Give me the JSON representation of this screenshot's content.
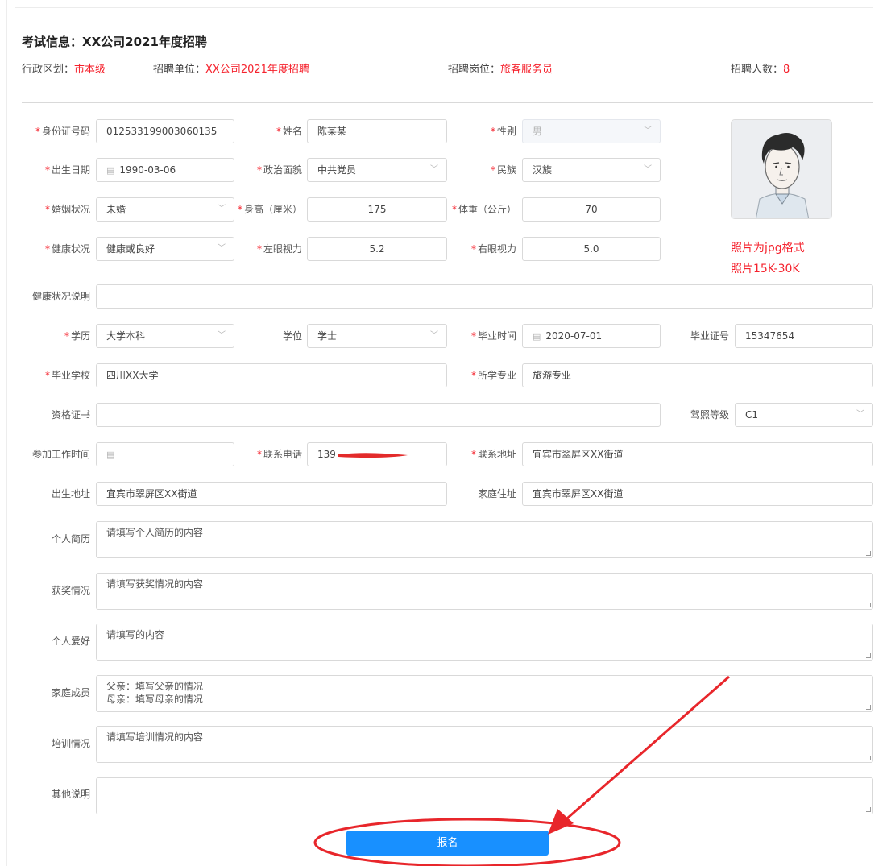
{
  "exam": {
    "title": "考试信息：XX公司2021年度招聘",
    "district_label": "行政区划：",
    "district_value": "市本级",
    "unit_label": "招聘单位：",
    "unit_value": "XX公司2021年度招聘",
    "post_label": "招聘岗位：",
    "post_value": "旅客服务员",
    "count_label": "招聘人数：",
    "count_value": "8"
  },
  "form": {
    "id_label": "身份证号码",
    "id_value": "012533199003060135",
    "name_label": "姓名",
    "name_value": "陈某某",
    "gender_label": "性别",
    "gender_value": "男",
    "birth_label": "出生日期",
    "birth_value": "1990-03-06",
    "politics_label": "政治面貌",
    "politics_value": "中共党员",
    "ethnic_label": "民族",
    "ethnic_value": "汉族",
    "marital_label": "婚姻状况",
    "marital_value": "未婚",
    "height_label": "身高（厘米）",
    "height_value": "175",
    "weight_label": "体重（公斤）",
    "weight_value": "70",
    "health_label": "健康状况",
    "health_value": "健康或良好",
    "left_eye_label": "左眼视力",
    "left_eye_value": "5.2",
    "right_eye_label": "右眼视力",
    "right_eye_value": "5.0",
    "health_note_label": "健康状况说明",
    "health_note_value": "",
    "education_label": "学历",
    "education_value": "大学本科",
    "degree_label": "学位",
    "degree_value": "学士",
    "grad_time_label": "毕业时间",
    "grad_time_value": "2020-07-01",
    "grad_cert_label": "毕业证号",
    "grad_cert_value": "15347654",
    "school_label": "毕业学校",
    "school_value": "四川XX大学",
    "major_label": "所学专业",
    "major_value": "旅游专业",
    "qualification_label": "资格证书",
    "qualification_value": "",
    "license_label": "驾照等级",
    "license_value": "C1",
    "work_start_label": "参加工作时间",
    "work_start_value": "",
    "phone_label": "联系电话",
    "phone_value": "139",
    "address_label": "联系地址",
    "address_value": "宜宾市翠屏区XX街道",
    "birthplace_label": "出生地址",
    "birthplace_value": "宜宾市翠屏区XX街道",
    "home_label": "家庭住址",
    "home_value": "宜宾市翠屏区XX街道",
    "resume_label": "个人简历",
    "resume_value": "请填写个人简历的内容",
    "awards_label": "获奖情况",
    "awards_value": "请填写获奖情况的内容",
    "hobby_label": "个人爱好",
    "hobby_value": "请填写的内容",
    "family_label": "家庭成员",
    "family_value": "父亲：填写父亲的情况\n母亲：填写母亲的情况",
    "training_label": "培训情况",
    "training_value": "请填写培训情况的内容",
    "other_label": "其他说明",
    "other_value": ""
  },
  "photo": {
    "note_format": "照片为jpg格式",
    "note_size": "照片15K-30K"
  },
  "submit": {
    "label": "报名"
  },
  "colors": {
    "accent": "#1890ff",
    "highlight": "#f5222d",
    "annotation": "#e8262b"
  },
  "icons": {
    "calendar": "calendar-icon",
    "dropdown": "chevron-down-icon"
  }
}
